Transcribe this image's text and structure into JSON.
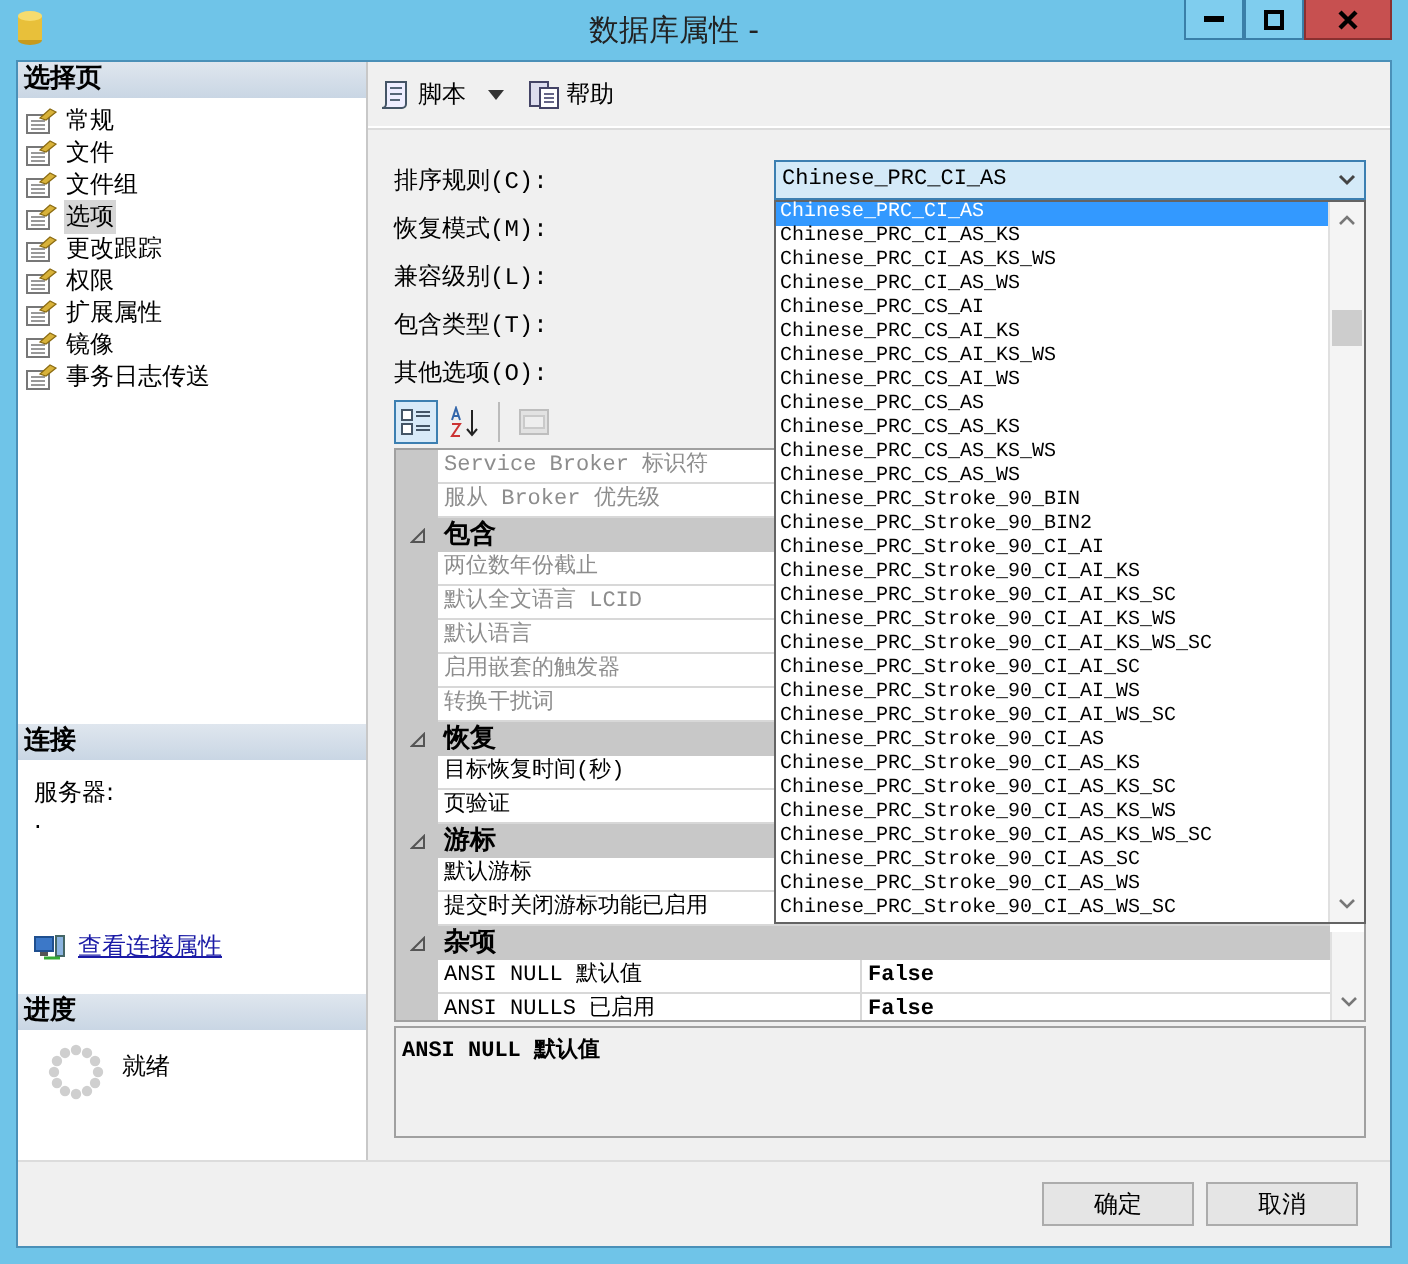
{
  "window": {
    "title": "数据库属性 -"
  },
  "select_page": {
    "title": "选择页",
    "items": [
      {
        "label": "常规",
        "selected": false
      },
      {
        "label": "文件",
        "selected": false
      },
      {
        "label": "文件组",
        "selected": false
      },
      {
        "label": "选项",
        "selected": true
      },
      {
        "label": "更改跟踪",
        "selected": false
      },
      {
        "label": "权限",
        "selected": false
      },
      {
        "label": "扩展属性",
        "selected": false
      },
      {
        "label": "镜像",
        "selected": false
      },
      {
        "label": "事务日志传送",
        "selected": false
      }
    ]
  },
  "connection": {
    "title": "连接",
    "server_label": "服务器:",
    "server_value": ".",
    "link": "查看连接属性"
  },
  "progress": {
    "title": "进度",
    "status": "就绪"
  },
  "toolbar": [
    {
      "label": "脚本",
      "kind": "script"
    },
    {
      "label": "帮助",
      "kind": "help"
    }
  ],
  "form": {
    "fields": [
      {
        "label": "排序规则(C):",
        "value": "Chinese_PRC_CI_AS",
        "expanded": true
      },
      {
        "label": "恢复模式(M):"
      },
      {
        "label": "兼容级别(L):"
      },
      {
        "label": "包含类型(T):"
      }
    ],
    "other_options": "其他选项(O):"
  },
  "collation_list": {
    "items": [
      {
        "label": "Chinese_PRC_CI_AS",
        "selected": true
      },
      {
        "label": "Chinese_PRC_CI_AS_KS",
        "selected": false
      },
      {
        "label": "Chinese_PRC_CI_AS_KS_WS",
        "selected": false
      },
      {
        "label": "Chinese_PRC_CI_AS_WS",
        "selected": false
      },
      {
        "label": "Chinese_PRC_CS_AI",
        "selected": false
      },
      {
        "label": "Chinese_PRC_CS_AI_KS",
        "selected": false
      },
      {
        "label": "Chinese_PRC_CS_AI_KS_WS",
        "selected": false
      },
      {
        "label": "Chinese_PRC_CS_AI_WS",
        "selected": false
      },
      {
        "label": "Chinese_PRC_CS_AS",
        "selected": false
      },
      {
        "label": "Chinese_PRC_CS_AS_KS",
        "selected": false
      },
      {
        "label": "Chinese_PRC_CS_AS_KS_WS",
        "selected": false
      },
      {
        "label": "Chinese_PRC_CS_AS_WS",
        "selected": false
      },
      {
        "label": "Chinese_PRC_Stroke_90_BIN",
        "selected": false
      },
      {
        "label": "Chinese_PRC_Stroke_90_BIN2",
        "selected": false
      },
      {
        "label": "Chinese_PRC_Stroke_90_CI_AI",
        "selected": false
      },
      {
        "label": "Chinese_PRC_Stroke_90_CI_AI_KS",
        "selected": false
      },
      {
        "label": "Chinese_PRC_Stroke_90_CI_AI_KS_SC",
        "selected": false
      },
      {
        "label": "Chinese_PRC_Stroke_90_CI_AI_KS_WS",
        "selected": false
      },
      {
        "label": "Chinese_PRC_Stroke_90_CI_AI_KS_WS_SC",
        "selected": false
      },
      {
        "label": "Chinese_PRC_Stroke_90_CI_AI_SC",
        "selected": false
      },
      {
        "label": "Chinese_PRC_Stroke_90_CI_AI_WS",
        "selected": false
      },
      {
        "label": "Chinese_PRC_Stroke_90_CI_AI_WS_SC",
        "selected": false
      },
      {
        "label": "Chinese_PRC_Stroke_90_CI_AS",
        "selected": false
      },
      {
        "label": "Chinese_PRC_Stroke_90_CI_AS_KS",
        "selected": false
      },
      {
        "label": "Chinese_PRC_Stroke_90_CI_AS_KS_SC",
        "selected": false
      },
      {
        "label": "Chinese_PRC_Stroke_90_CI_AS_KS_WS",
        "selected": false
      },
      {
        "label": "Chinese_PRC_Stroke_90_CI_AS_KS_WS_SC",
        "selected": false
      },
      {
        "label": "Chinese_PRC_Stroke_90_CI_AS_SC",
        "selected": false
      },
      {
        "label": "Chinese_PRC_Stroke_90_CI_AS_WS",
        "selected": false
      },
      {
        "label": "Chinese_PRC_Stroke_90_CI_AS_WS_SC",
        "selected": false
      }
    ]
  },
  "grid_toolbar": [
    {
      "kind": "categorized",
      "selected": true
    },
    {
      "kind": "alphabetical",
      "selected": false
    },
    {
      "kind": "property_pages",
      "disabled": true
    }
  ],
  "property_grid": {
    "rows": [
      {
        "kind": "property",
        "name": "Service Broker 标识符",
        "disabled": true
      },
      {
        "kind": "property",
        "name": "服从 Broker 优先级",
        "disabled": true
      },
      {
        "kind": "category",
        "name": "包含",
        "expanded": true
      },
      {
        "kind": "property",
        "name": "两位数年份截止",
        "disabled": true
      },
      {
        "kind": "property",
        "name": "默认全文语言 LCID",
        "disabled": true
      },
      {
        "kind": "property",
        "name": "默认语言",
        "disabled": true
      },
      {
        "kind": "property",
        "name": "启用嵌套的触发器",
        "disabled": true
      },
      {
        "kind": "property",
        "name": "转换干扰词",
        "disabled": true
      },
      {
        "kind": "category",
        "name": "恢复",
        "expanded": true
      },
      {
        "kind": "property",
        "name": "目标恢复时间(秒)",
        "disabled": false
      },
      {
        "kind": "property",
        "name": "页验证",
        "disabled": false
      },
      {
        "kind": "category",
        "name": "游标",
        "expanded": true
      },
      {
        "kind": "property",
        "name": "默认游标",
        "disabled": false
      },
      {
        "kind": "property",
        "name": "提交时关闭游标功能已启用",
        "disabled": false
      },
      {
        "kind": "category",
        "name": "杂项",
        "expanded": true
      },
      {
        "kind": "property",
        "name": "ANSI NULL 默认值",
        "value": "False",
        "disabled": false
      },
      {
        "kind": "property",
        "name": "ANSI NULLS 已启用",
        "value": "False",
        "disabled": false
      }
    ]
  },
  "description": {
    "text": "ANSI NULL 默认值"
  },
  "buttons": [
    {
      "label": "确定"
    },
    {
      "label": "取消"
    }
  ]
}
